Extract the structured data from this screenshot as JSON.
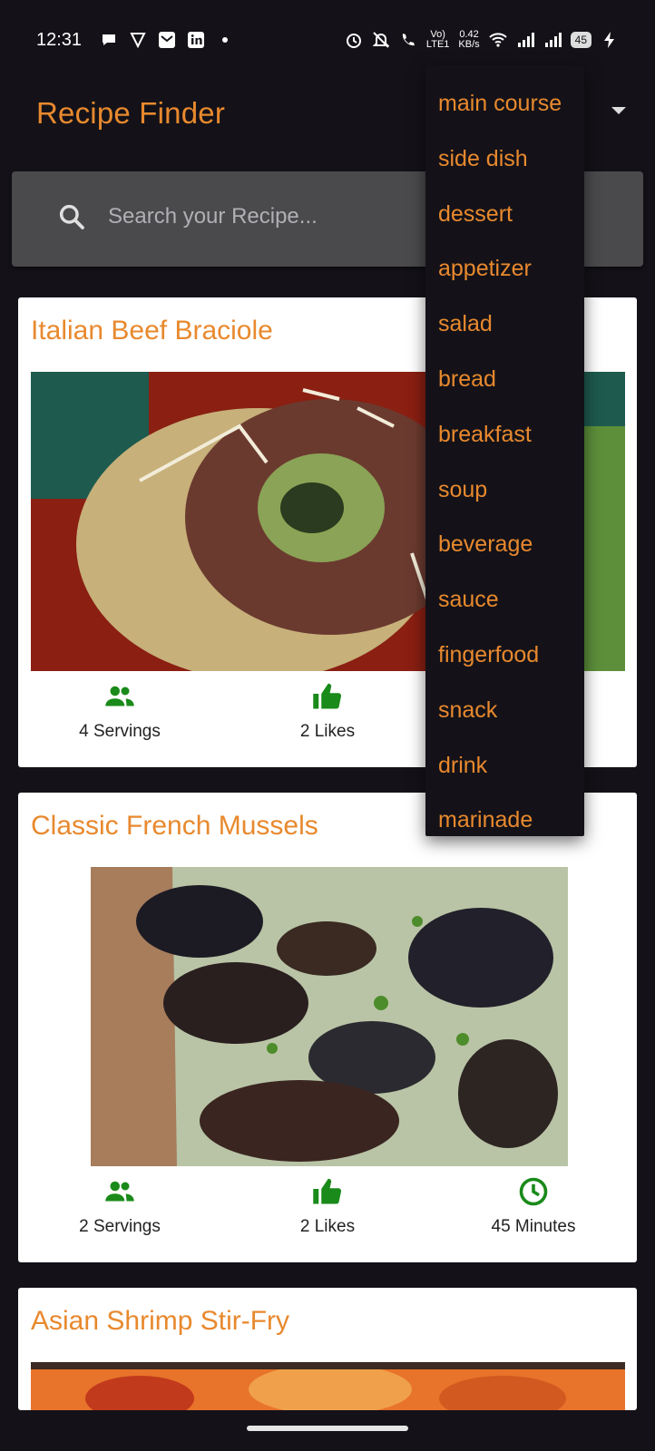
{
  "status_bar": {
    "time": "12:31",
    "network_speed_value": "0.42",
    "network_speed_unit": "KB/s",
    "signal_label": "LTE1",
    "volte_label": "Vo)",
    "sim_label": "2",
    "battery": "45"
  },
  "app": {
    "title": "Recipe Finder"
  },
  "search": {
    "placeholder": "Search your Recipe..."
  },
  "dropdown": {
    "items": [
      "main course",
      "side dish",
      "dessert",
      "appetizer",
      "salad",
      "bread",
      "breakfast",
      "soup",
      "beverage",
      "sauce",
      "fingerfood",
      "snack",
      "drink",
      "marinade"
    ]
  },
  "recipes": [
    {
      "title": "Italian Beef Braciole",
      "servings": "4 Servings",
      "likes": "2 Likes",
      "minutes": ""
    },
    {
      "title": "Classic French Mussels",
      "servings": "2 Servings",
      "likes": "2 Likes",
      "minutes": "45 Minutes"
    },
    {
      "title": "Asian Shrimp Stir-Fry"
    }
  ],
  "colors": {
    "accent": "#E8892E",
    "stat_icon": "#1a8a1a",
    "background": "#141218"
  }
}
